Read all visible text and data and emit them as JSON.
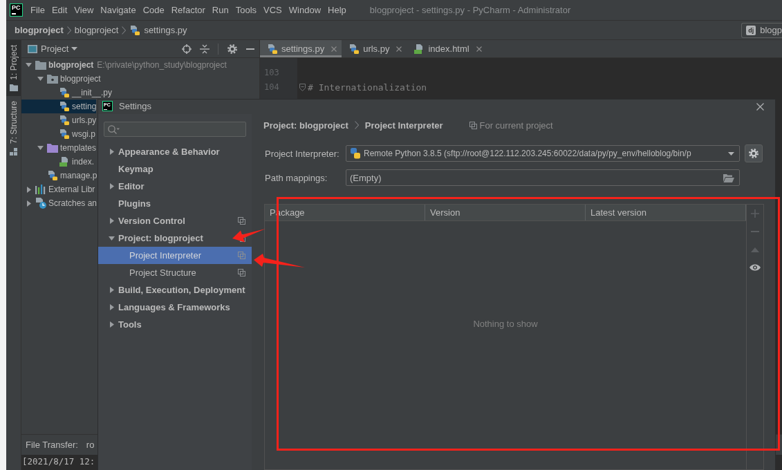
{
  "window": {
    "logo": "PC",
    "title": "blogproject - settings.py - PyCharm - Administrator"
  },
  "menu": [
    "File",
    "Edit",
    "View",
    "Navigate",
    "Code",
    "Refactor",
    "Run",
    "Tools",
    "VCS",
    "Window",
    "Help"
  ],
  "navigation_bar": {
    "breadcrumbs": [
      {
        "label": "blogproject",
        "kind": "project"
      },
      {
        "label": "blogproject",
        "kind": "folder"
      },
      {
        "label": "settings.py",
        "kind": "python"
      }
    ],
    "run_config": {
      "badge": "dj",
      "label": "blogp"
    }
  },
  "tool_strip": [
    {
      "label": "1: Project",
      "kind": "project",
      "selected": true
    },
    {
      "label": "7: Structure",
      "kind": "structure",
      "selected": false
    }
  ],
  "project_panel": {
    "title": "Project",
    "tree": [
      {
        "label": "blogproject",
        "kind": "root",
        "path": "E:\\private\\python_study\\blogproject",
        "expanded": true,
        "selected": false,
        "children": [
          {
            "label": "blogproject",
            "kind": "package",
            "expanded": true,
            "selected": false,
            "children": [
              {
                "label": "__init__.py",
                "kind": "python",
                "selected": false
              },
              {
                "label": "setting",
                "kind": "python",
                "selected": true
              },
              {
                "label": "urls.py",
                "kind": "python",
                "selected": false
              },
              {
                "label": "wsgi.p",
                "kind": "python",
                "selected": false
              }
            ]
          },
          {
            "label": "templates",
            "kind": "templates",
            "expanded": true,
            "selected": false,
            "children": [
              {
                "label": "index.",
                "kind": "html",
                "selected": false
              }
            ]
          },
          {
            "label": "manage.p",
            "kind": "python",
            "selected": false
          }
        ]
      },
      {
        "label": "External Libr",
        "kind": "libraries",
        "expanded": false,
        "selected": false
      },
      {
        "label": "Scratches an",
        "kind": "scratches",
        "expanded": false,
        "selected": false
      }
    ]
  },
  "editor": {
    "tabs": [
      {
        "label": "settings.py",
        "kind": "python",
        "selected": true
      },
      {
        "label": "urls.py",
        "kind": "python",
        "selected": false
      },
      {
        "label": "index.html",
        "kind": "html",
        "selected": false
      }
    ],
    "lines": [
      {
        "number": "103",
        "fold": false
      },
      {
        "number": "104",
        "text": "# Internationalization",
        "kind": "comment",
        "fold": true
      }
    ]
  },
  "bottom_panel": {
    "title": "File Transfer:",
    "tab": "ro",
    "log": "[2021/8/17 12:"
  },
  "settings_dialog": {
    "logo": "PC",
    "title": "Settings",
    "tree": [
      {
        "label": "Appearance & Behavior",
        "expanded": false,
        "selected": false,
        "project_level": false
      },
      {
        "label": "Keymap",
        "selected": false,
        "project_level": false
      },
      {
        "label": "Editor",
        "expanded": false,
        "selected": false,
        "project_level": false
      },
      {
        "label": "Plugins",
        "selected": false,
        "project_level": false
      },
      {
        "label": "Version Control",
        "expanded": false,
        "selected": false,
        "project_level": true
      },
      {
        "label": "Project: blogproject",
        "expanded": true,
        "selected": false,
        "project_level": true,
        "children": [
          {
            "label": "Project Interpreter",
            "selected": true,
            "project_level": true
          },
          {
            "label": "Project Structure",
            "selected": false,
            "project_level": true
          }
        ]
      },
      {
        "label": "Build, Execution, Deployment",
        "expanded": false,
        "selected": false,
        "project_level": false
      },
      {
        "label": "Languages & Frameworks",
        "expanded": false,
        "selected": false,
        "project_level": false
      },
      {
        "label": "Tools",
        "expanded": false,
        "selected": false,
        "project_level": false
      }
    ],
    "breadcrumb": [
      "Project: blogproject",
      "Project Interpreter"
    ],
    "scope_note": "For current project",
    "interpreter": {
      "label": "Project Interpreter:",
      "value": "Remote Python 3.8.5 (sftp://root@122.112.203.245:60022/data/py/py_env/helloblog/bin/p"
    },
    "path_mappings": {
      "label": "Path mappings:",
      "value": "(Empty)"
    },
    "packages": {
      "columns": [
        "Package",
        "Version",
        "Latest version"
      ],
      "empty_text": "Nothing to show",
      "toolbar": [
        {
          "kind": "add",
          "disabled": true
        },
        {
          "kind": "remove",
          "disabled": true
        },
        {
          "kind": "upgrade",
          "disabled": true
        },
        {
          "kind": "show-early-releases",
          "disabled": false
        }
      ]
    }
  }
}
